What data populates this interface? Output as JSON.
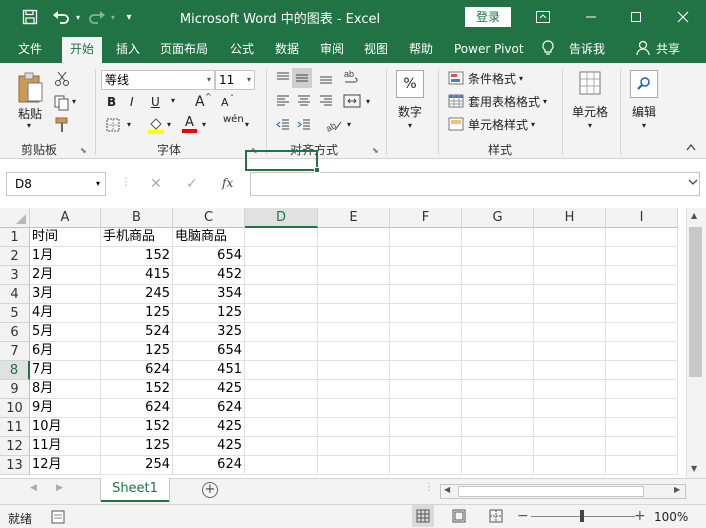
{
  "titlebar": {
    "title": "Microsoft Word 中的图表 - Excel",
    "login_label": "登录",
    "qat_more": "▾"
  },
  "tabs": [
    {
      "label": "文件"
    },
    {
      "label": "开始"
    },
    {
      "label": "插入"
    },
    {
      "label": "页面布局"
    },
    {
      "label": "公式"
    },
    {
      "label": "数据"
    },
    {
      "label": "审阅"
    },
    {
      "label": "视图"
    },
    {
      "label": "帮助"
    },
    {
      "label": "Power Pivot"
    },
    {
      "label": "告诉我"
    },
    {
      "label": "共享"
    }
  ],
  "ribbon": {
    "clipboard": {
      "paste": "粘贴",
      "group": "剪贴板"
    },
    "font": {
      "name": "等线",
      "size": "11",
      "bold": "B",
      "italic": "I",
      "underline": "U",
      "group": "字体",
      "grow": "A",
      "shrink": "A",
      "font_color_glyph": "A",
      "phonetic": "wén"
    },
    "alignment": {
      "group": "对齐方式"
    },
    "number": {
      "label": "数字",
      "glyph": "%"
    },
    "styles": {
      "conditional": "条件格式",
      "table": "套用表格格式",
      "cell": "单元格样式",
      "group": "样式"
    },
    "cells": {
      "label": "单元格"
    },
    "editing": {
      "label": "编辑"
    }
  },
  "formula_bar": {
    "name_box": "D8",
    "value": "",
    "fx": "fx"
  },
  "columns": [
    "A",
    "B",
    "C",
    "D",
    "E",
    "F",
    "G",
    "H",
    "I"
  ],
  "rows": [
    {
      "n": "1",
      "a": "时间",
      "b": "手机商品",
      "c": "电脑商品"
    },
    {
      "n": "2",
      "a": "1月",
      "b": "152",
      "c": "654"
    },
    {
      "n": "3",
      "a": "2月",
      "b": "415",
      "c": "452"
    },
    {
      "n": "4",
      "a": "3月",
      "b": "245",
      "c": "354"
    },
    {
      "n": "5",
      "a": "4月",
      "b": "125",
      "c": "125"
    },
    {
      "n": "6",
      "a": "5月",
      "b": "524",
      "c": "325"
    },
    {
      "n": "7",
      "a": "6月",
      "b": "125",
      "c": "654"
    },
    {
      "n": "8",
      "a": "7月",
      "b": "624",
      "c": "451"
    },
    {
      "n": "9",
      "a": "8月",
      "b": "152",
      "c": "425"
    },
    {
      "n": "10",
      "a": "9月",
      "b": "624",
      "c": "624"
    },
    {
      "n": "11",
      "a": "10月",
      "b": "152",
      "c": "425"
    },
    {
      "n": "12",
      "a": "11月",
      "b": "125",
      "c": "425"
    },
    {
      "n": "13",
      "a": "12月",
      "b": "254",
      "c": "624"
    }
  ],
  "selected_cell": "D8",
  "sheets": [
    {
      "label": "Sheet1"
    }
  ],
  "statusbar": {
    "mode": "就绪",
    "zoom": "100%"
  },
  "colors": {
    "accent": "#217346"
  }
}
